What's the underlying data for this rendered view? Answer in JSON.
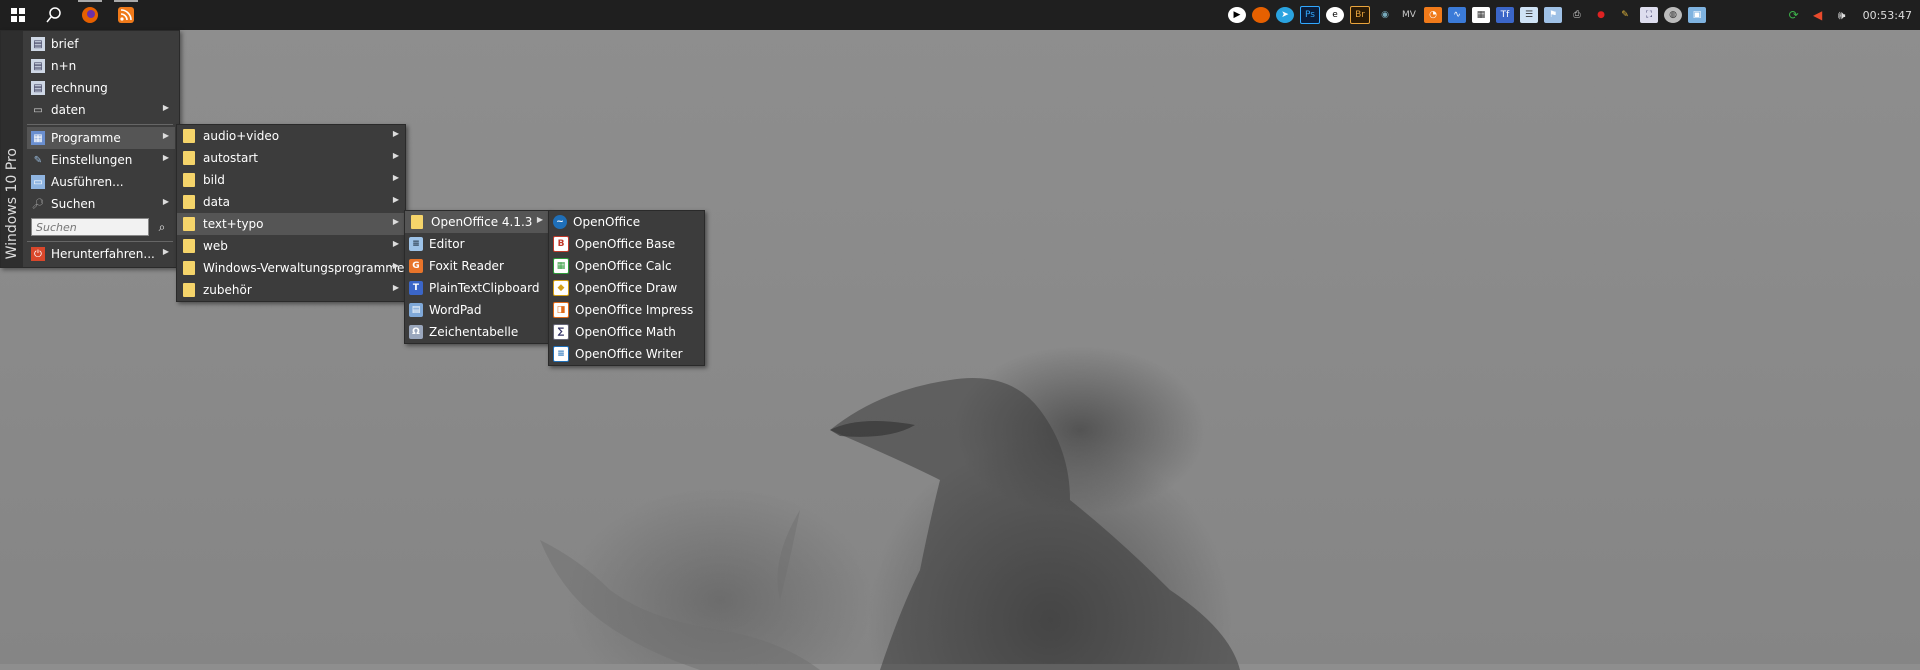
{
  "taskbar": {
    "pinned": [
      "windows-start-icon",
      "search-icon",
      "firefox-icon",
      "rss-feed-icon"
    ],
    "tray_icons": [
      "play-icon",
      "firefox-icon",
      "telegram-icon",
      "photoshop-icon",
      "edge-icon",
      "bridge-icon",
      "eye-icon",
      "mv-icon",
      "rss-icon",
      "chart-icon",
      "calculator-icon",
      "font-icon",
      "notes-icon",
      "flag-icon",
      "printer-icon",
      "marker-icon",
      "gold-icon",
      "screenshot-icon",
      "globe-icon",
      "window-icon"
    ],
    "system_icons": [
      "network-icon",
      "antivirus-icon",
      "volume-icon"
    ],
    "clock": "00:53:47"
  },
  "start_menu": {
    "brand": "Windows 10 Pro",
    "top_items": [
      {
        "label": "brief",
        "icon": "document-icon"
      },
      {
        "label": "n+n",
        "icon": "document-icon"
      },
      {
        "label": "rechnung",
        "icon": "document-icon"
      },
      {
        "label": "daten",
        "icon": "drive-icon"
      }
    ],
    "items": [
      {
        "label": "Programme",
        "icon": "programs-icon"
      },
      {
        "label": "Einstellungen",
        "icon": "settings-icon"
      },
      {
        "label": "Ausführen...",
        "icon": "run-icon"
      },
      {
        "label": "Suchen",
        "icon": "search-icon"
      }
    ],
    "search_placeholder": "Suchen",
    "shutdown": "Herunterfahren..."
  },
  "programs_menu": [
    "audio+video",
    "autostart",
    "bild",
    "data",
    "text+typo",
    "web",
    "Windows-Verwaltungsprogramme",
    "zubehör"
  ],
  "texttypo_menu": [
    {
      "label": "OpenOffice 4.1.3",
      "icon": "folder-icon"
    },
    {
      "label": "Editor",
      "icon": "notepad-icon"
    },
    {
      "label": "Foxit Reader",
      "icon": "foxit-icon"
    },
    {
      "label": "PlainTextClipboard",
      "icon": "clipboard-icon"
    },
    {
      "label": "WordPad",
      "icon": "wordpad-icon"
    },
    {
      "label": "Zeichentabelle",
      "icon": "charmap-icon"
    }
  ],
  "openoffice_menu": [
    {
      "label": "OpenOffice",
      "icon": "openoffice-icon"
    },
    {
      "label": "OpenOffice Base",
      "icon": "base-icon"
    },
    {
      "label": "OpenOffice Calc",
      "icon": "calc-icon"
    },
    {
      "label": "OpenOffice Draw",
      "icon": "draw-icon"
    },
    {
      "label": "OpenOffice Impress",
      "icon": "impress-icon"
    },
    {
      "label": "OpenOffice Math",
      "icon": "math-icon"
    },
    {
      "label": "OpenOffice Writer",
      "icon": "writer-icon"
    }
  ]
}
